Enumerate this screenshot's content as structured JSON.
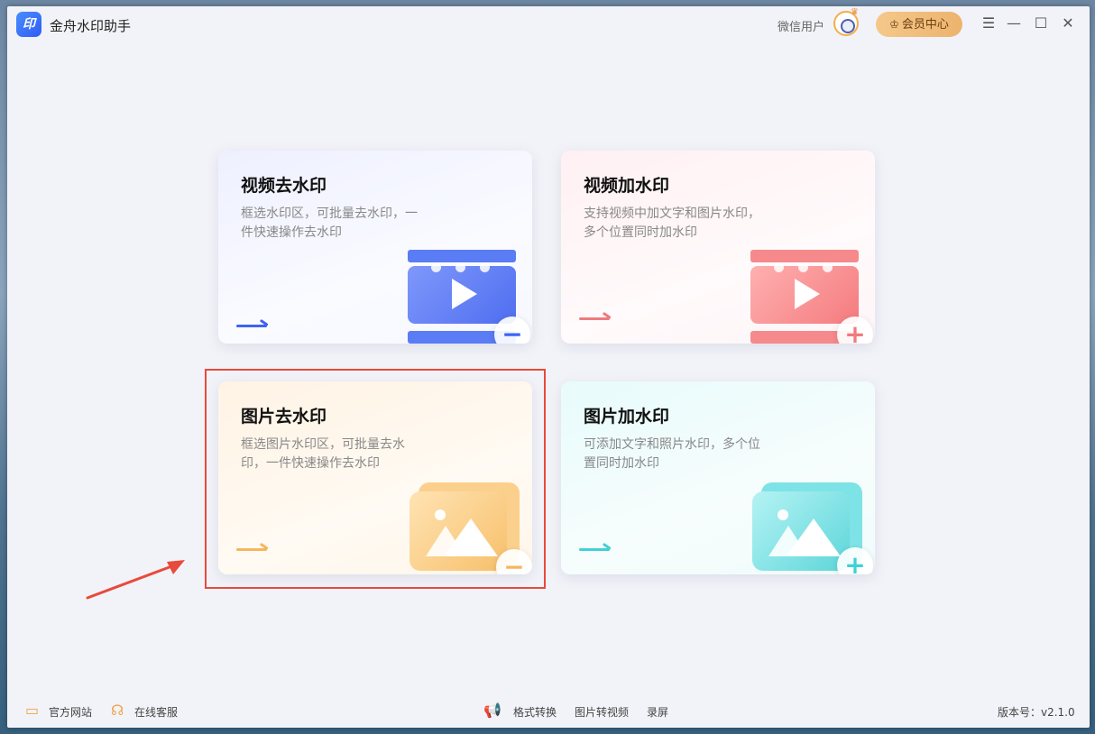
{
  "app": {
    "logo_text": "印",
    "title": "金舟水印助手"
  },
  "header": {
    "user_name": "微信用户",
    "member_center_label": "会员中心",
    "member_icon": "crown-outline-icon",
    "window_controls": {
      "menu": "☰",
      "minimize": "—",
      "maximize": "☐",
      "close": "✕"
    }
  },
  "cards": [
    {
      "id": "video-remove",
      "title": "视频去水印",
      "desc": "框选水印区，可批量去水印，一件快速操作去水印",
      "accent": "#3e63f2",
      "badge": "−",
      "illustration": "film-icon"
    },
    {
      "id": "video-add",
      "title": "视频加水印",
      "desc": "支持视频中加文字和图片水印，多个位置同时加水印",
      "accent": "#f07a7e",
      "badge": "+",
      "illustration": "film-icon"
    },
    {
      "id": "image-remove",
      "title": "图片去水印",
      "desc": "框选图片水印区，可批量去水印，一件快速操作去水印",
      "accent": "#f5b65c",
      "badge": "−",
      "illustration": "picture-icon"
    },
    {
      "id": "image-add",
      "title": "图片加水印",
      "desc": "可添加文字和照片水印，多个位置同时加水印",
      "accent": "#3fd1d6",
      "badge": "+",
      "illustration": "picture-icon"
    }
  ],
  "footer": {
    "official_site": "官方网站",
    "online_service": "在线客服",
    "format_convert": "格式转换",
    "image_to_video": "图片转视频",
    "screen_record": "录屏",
    "version": "版本号：v2.1.0"
  },
  "colors": {
    "highlight_box": "#e84a3c",
    "annotation_arrow": "#e84a3c",
    "window_bg": "#f2f3f8"
  }
}
